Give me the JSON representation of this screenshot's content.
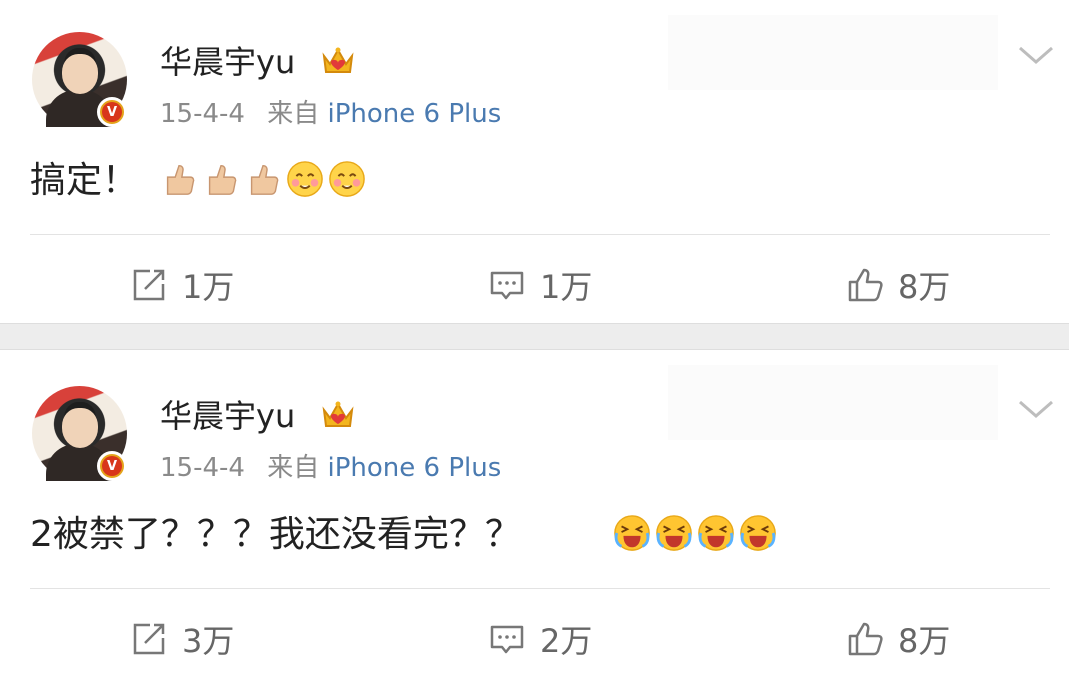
{
  "posts": [
    {
      "username": "华晨宇yu",
      "date": "15-4-4",
      "source_prefix": "来自",
      "source": "iPhone 6 Plus",
      "content": "搞定！",
      "emojis": [
        "thumbs-up-icon",
        "thumbs-up-icon",
        "thumbs-up-icon",
        "blush-icon",
        "blush-icon"
      ],
      "repost_count": "1万",
      "comment_count": "1万",
      "like_count": "8万"
    },
    {
      "username": "华晨宇yu",
      "date": "15-4-4",
      "source_prefix": "来自",
      "source": "iPhone 6 Plus",
      "content": "2被禁了？？？我还没看完？？",
      "emojis": [
        "crying-face-icon",
        "crying-face-icon",
        "crying-face-icon",
        "crying-face-icon"
      ],
      "repost_count": "3万",
      "comment_count": "2万",
      "like_count": "8万"
    }
  ],
  "colors": {
    "source_link": "#4a7ab0",
    "meta_gray": "#8a8a8a",
    "verified_badge": "#d8361b",
    "separator": "#ededed"
  },
  "verified_badge_letter": "V"
}
